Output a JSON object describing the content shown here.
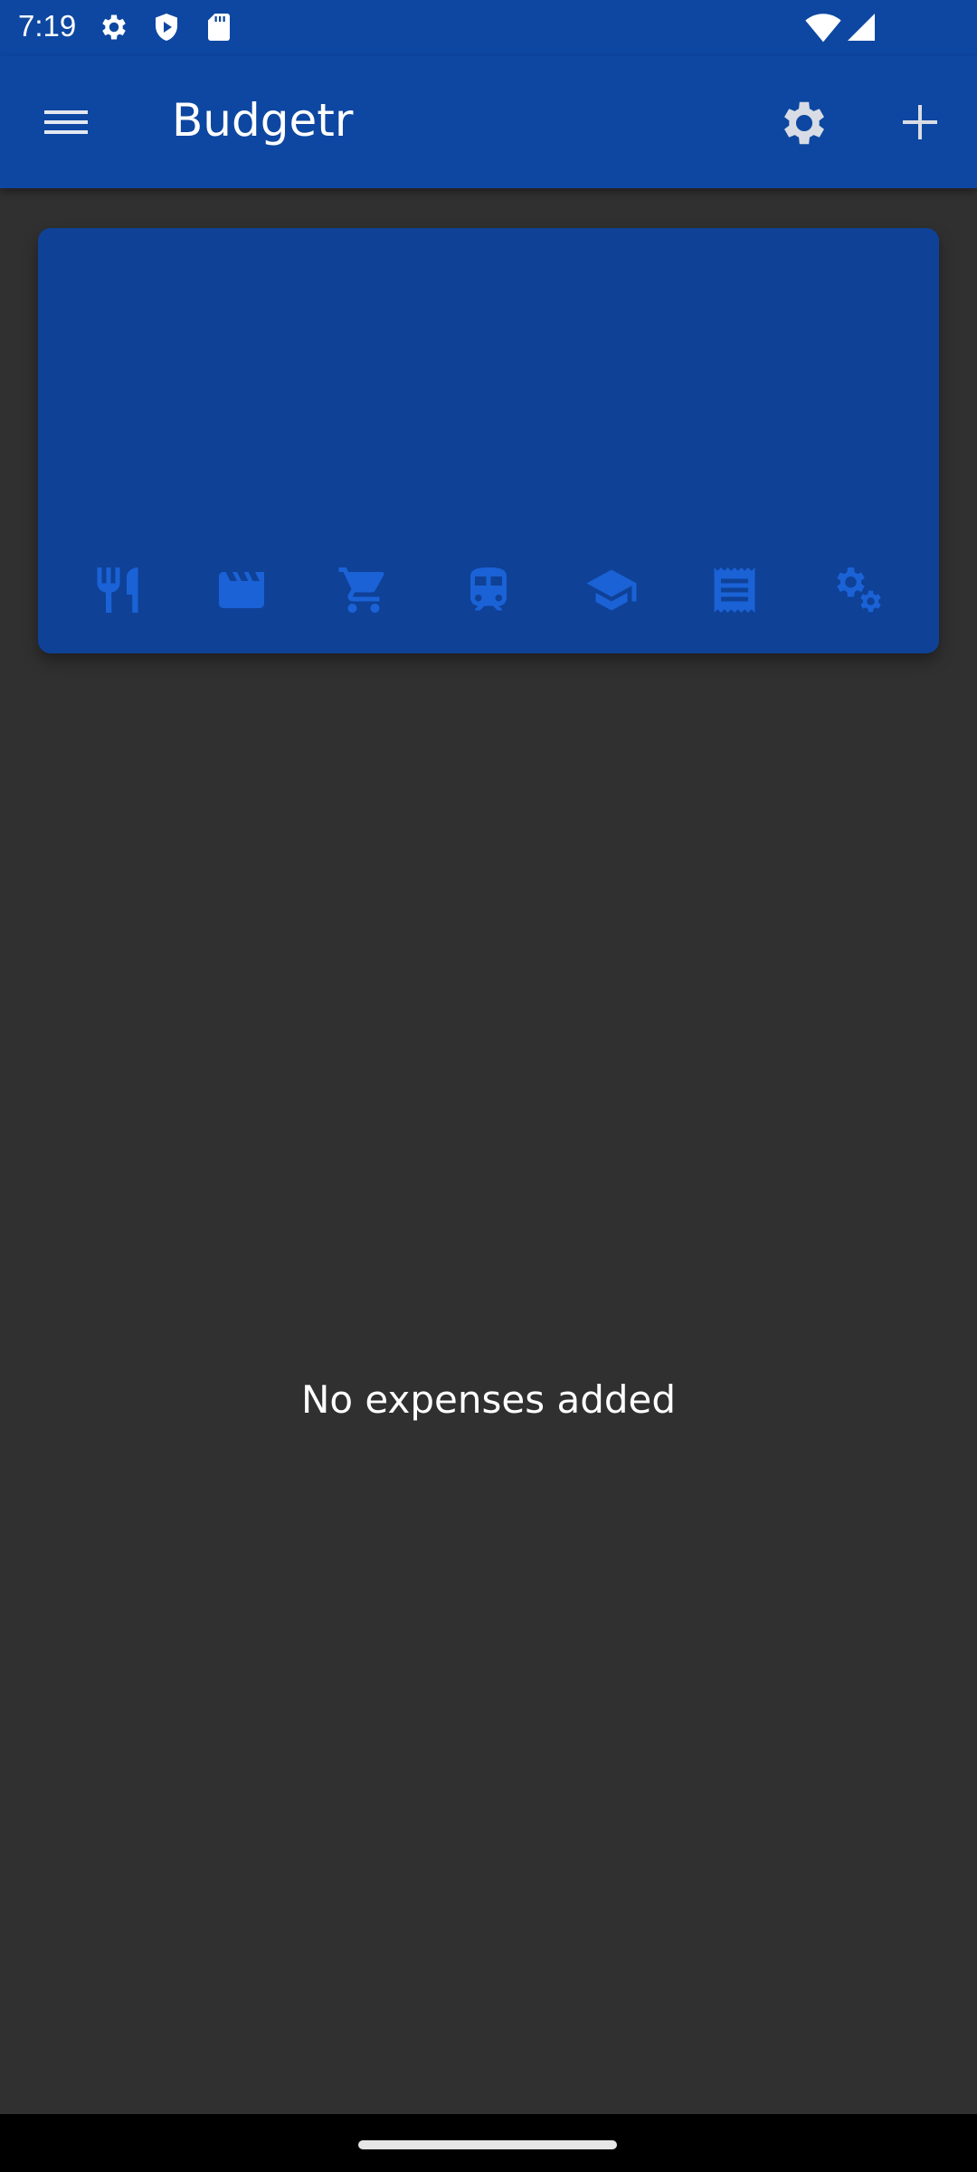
{
  "status_bar": {
    "time": "7:19",
    "left_icons": [
      "gear-icon",
      "play-shield-icon",
      "sd-card-icon"
    ],
    "right_icons": [
      "wifi-icon",
      "signal-icon"
    ]
  },
  "app_bar": {
    "title": "Budgetr",
    "menu_icon": "hamburger-menu-icon",
    "settings_icon": "gear-icon",
    "add_icon": "plus-icon"
  },
  "categories": [
    {
      "icon": "restaurant-icon"
    },
    {
      "icon": "movie-clapper-icon"
    },
    {
      "icon": "shopping-cart-icon"
    },
    {
      "icon": "train-icon"
    },
    {
      "icon": "school-icon"
    },
    {
      "icon": "receipt-icon"
    },
    {
      "icon": "settings-gears-icon"
    }
  ],
  "empty_state": {
    "message": "No expenses added"
  },
  "colors": {
    "primary": "#0d47a1",
    "card": "#0f4197",
    "category_icon": "#1a62d6",
    "background": "#303030"
  }
}
